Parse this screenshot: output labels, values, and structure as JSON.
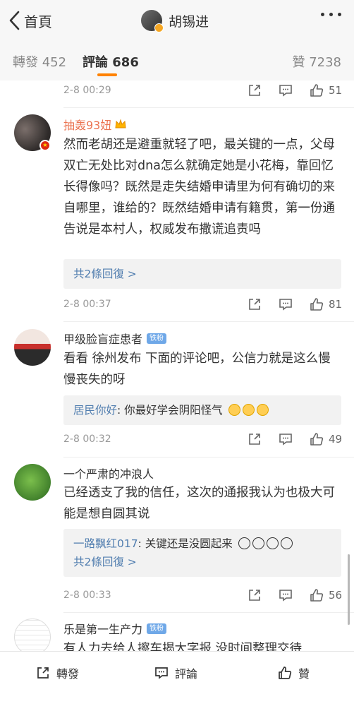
{
  "header": {
    "back_label": "首頁",
    "title": "胡锡进"
  },
  "tabs": {
    "repost": "轉發 452",
    "comments": "評論 686",
    "likes": "贊 7238"
  },
  "top_meta": {
    "time": "2-8 00:29",
    "likes": "51"
  },
  "comments": [
    {
      "name": "抽轰93妞",
      "text": "然而老胡还是避重就轻了吧，最关键的一点，父母双亡无处比对dna怎么就确定她是小花梅，靠回忆长得像吗？既然是走失结婚申请里为何有确切的来自哪里，谁给的？既然结婚申请有籍贯，第一份通告说是本村人，权威发布撒谎追责吗",
      "reply_link": "共2條回復 >",
      "time": "2-8 00:37",
      "likes": "81"
    },
    {
      "name": "甲级脸盲症患者",
      "badge": "铁粉",
      "text": "看看 徐州发布 下面的评论吧，公信力就是这么慢慢丧失的呀",
      "reply_user": "居民你好",
      "reply_text": ": 你最好学会阴阳怪气",
      "time": "2-8 00:32",
      "likes": "49"
    },
    {
      "name": "一个严肃的冲浪人",
      "text": "已经透支了我的信任，这次的通报我认为也极大可能是想自圆其说",
      "reply_user": "一路飘红017",
      "reply_text": ": 关键还是没圆起来",
      "reply_link": "共2條回復 >",
      "time": "2-8 00:33",
      "likes": "56"
    },
    {
      "name": "乐是第一生产力",
      "badge": "铁粉",
      "text": "有人力去给人擦车揭大字报 没时间整理交待"
    }
  ],
  "bottom_bar": {
    "repost": "轉發",
    "comment": "評論",
    "like": "贊"
  },
  "colors": {
    "accent": "#ff8200",
    "link": "#507daf",
    "vip_name": "#eb7350"
  }
}
